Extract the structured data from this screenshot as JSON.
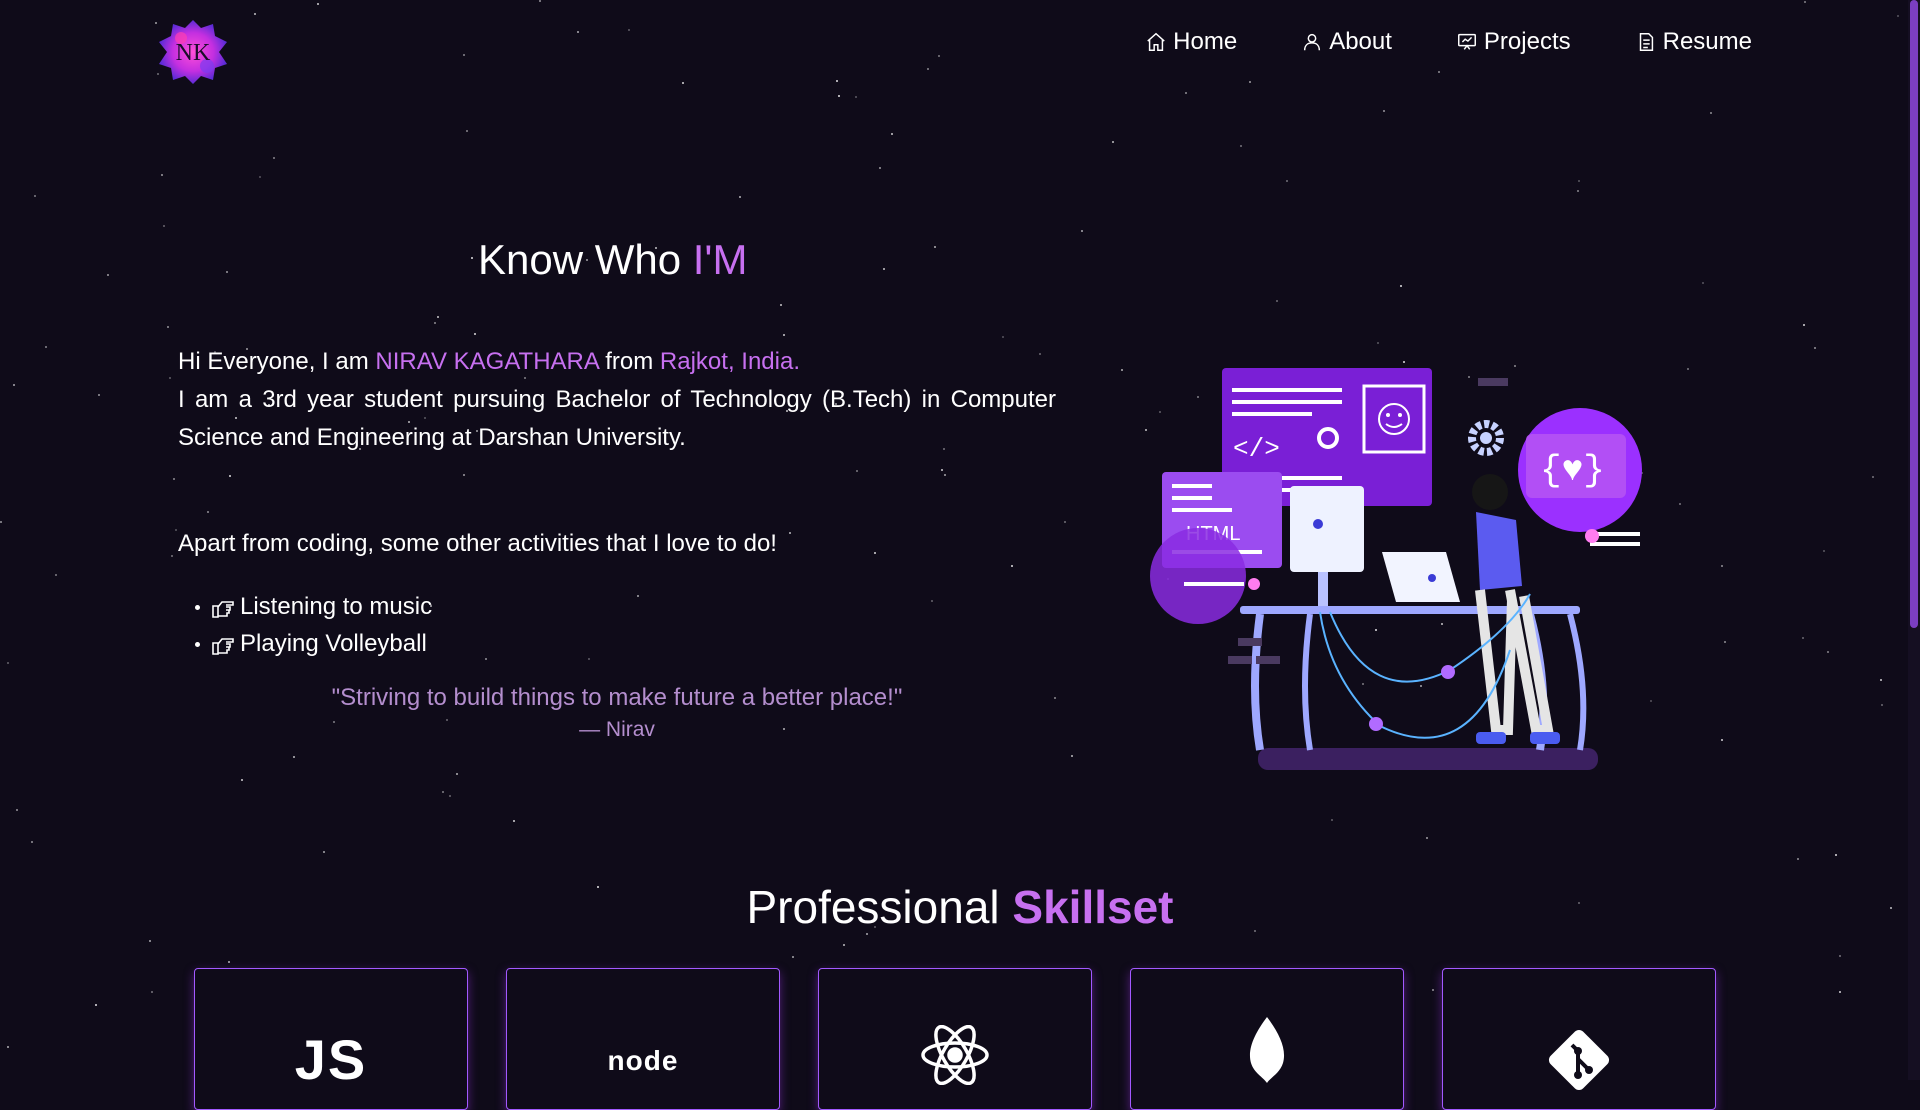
{
  "navbar": {
    "logo_text": "NK",
    "items": [
      {
        "label": "Home",
        "icon": "home-icon"
      },
      {
        "label": "About",
        "icon": "user-icon"
      },
      {
        "label": "Projects",
        "icon": "presentation-icon"
      },
      {
        "label": "Resume",
        "icon": "document-icon"
      }
    ]
  },
  "about": {
    "title_prefix": "Know Who ",
    "title_accent": "I'M",
    "intro_line1_prefix": "Hi Everyone, I am ",
    "name": "NIRAV KAGATHARA",
    "intro_from": " from ",
    "location": "Rajkot, India.",
    "intro_line2": "I am a 3rd year student pursuing Bachelor of Technology (B.Tech) in Computer Science and Engineering at Darshan University.",
    "activities_title": "Apart from coding, some other activities that I love to do!",
    "activities": [
      "Listening to music",
      "Playing Volleyball"
    ],
    "quote": "\"Striving to build things to make future a better place!\"",
    "quote_author": "— Nirav",
    "illustration": {
      "html_label": "HTML"
    }
  },
  "skills": {
    "title_prefix": "Professional ",
    "title_accent": "Skillset",
    "items": [
      {
        "icon": "javascript-icon",
        "text": "JS"
      },
      {
        "icon": "nodejs-icon",
        "text": "node"
      },
      {
        "icon": "react-icon"
      },
      {
        "icon": "mongodb-icon"
      },
      {
        "icon": "git-icon"
      }
    ]
  },
  "colors": {
    "background": "#0f0b19",
    "accent": "#c770f0",
    "card_border": "#a259ff",
    "quote": "#b48ece"
  }
}
